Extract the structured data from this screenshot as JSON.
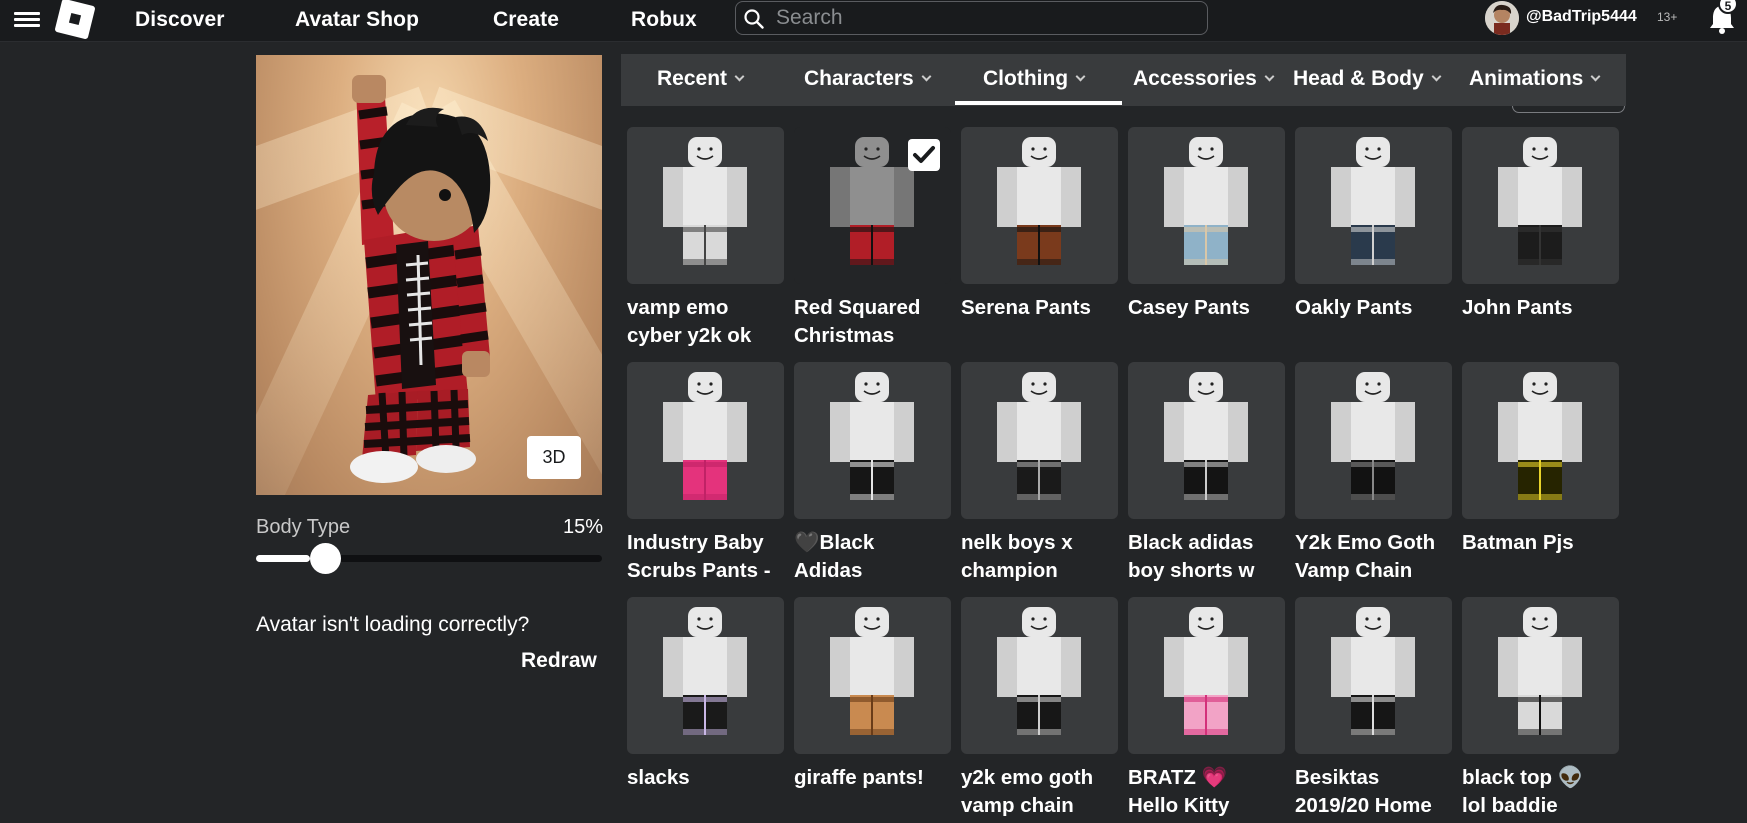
{
  "topbar": {
    "nav": [
      {
        "label": "Discover"
      },
      {
        "label": "Avatar Shop"
      },
      {
        "label": "Create"
      },
      {
        "label": "Robux"
      }
    ],
    "search_placeholder": "Search",
    "username": "@BadTrip5444",
    "age_tag": "13+",
    "notification_count": "5"
  },
  "preview": {
    "view_toggle_label": "3D",
    "body_type_label": "Body Type",
    "body_type_value": "15%",
    "body_type_fraction": 0.15,
    "loading_question": "Avatar isn't loading correctly?",
    "redraw_label": "Redraw"
  },
  "tabs": [
    {
      "label": "Recent"
    },
    {
      "label": "Characters"
    },
    {
      "label": "Clothing",
      "active": true
    },
    {
      "label": "Accessories"
    },
    {
      "label": "Head & Body"
    },
    {
      "label": "Animations"
    }
  ],
  "items": [
    {
      "line1": "vamp emo",
      "line2": "cyber y2k ok",
      "pants": "#d9d9d9",
      "accent": "#444"
    },
    {
      "line1": "Red Squared",
      "line2": "Christmas",
      "pants": "#b11e27",
      "accent": "#111",
      "selected": true
    },
    {
      "line1": "Serena Pants",
      "line2": "",
      "pants": "#7a3a1c",
      "accent": "#111"
    },
    {
      "line1": "Casey Pants",
      "line2": "",
      "pants": "#8fb2c8",
      "accent": "#d9c7a8"
    },
    {
      "line1": "Oakly Pants",
      "line2": "",
      "pants": "#2a3a4c",
      "accent": "#d0d0d0"
    },
    {
      "line1": "John Pants",
      "line2": "",
      "pants": "#1c1c1c",
      "accent": "#333"
    },
    {
      "line1": "Industry Baby",
      "line2": "Scrubs Pants -",
      "pants": "#e4337c",
      "accent": "#c02266"
    },
    {
      "line1": "🖤Black",
      "line2": "Adidas",
      "pants": "#161616",
      "accent": "#e6e6e6"
    },
    {
      "line1": "nelk boys x",
      "line2": "champion",
      "pants": "#1a1a1a",
      "accent": "#aaa"
    },
    {
      "line1": "Black adidas",
      "line2": "boy shorts w",
      "pants": "#141414",
      "accent": "#ccc"
    },
    {
      "line1": "Y2k Emo Goth",
      "line2": "Vamp Chain",
      "pants": "#121212",
      "accent": "#888"
    },
    {
      "line1": "Batman Pjs",
      "line2": "",
      "pants": "#262400",
      "accent": "#e8d22a"
    },
    {
      "line1": "slacks",
      "line2": "",
      "pants": "#1a1a1a",
      "accent": "#c9b7e6"
    },
    {
      "line1": "giraffe pants!",
      "line2": "",
      "pants": "#c98a50",
      "accent": "#6a3c18"
    },
    {
      "line1": "y2k emo goth",
      "line2": "vamp chain",
      "pants": "#171717",
      "accent": "#cfcfcf"
    },
    {
      "line1": "BRATZ 💗",
      "line2": "Hello Kitty",
      "pants": "#f2a3c6",
      "accent": "#d3307a"
    },
    {
      "line1": "Besiktas",
      "line2": "2019/20 Home",
      "pants": "#161616",
      "accent": "#ddd"
    },
    {
      "line1": "black top 👽",
      "line2": "lol baddie",
      "pants": "#d9d9d9",
      "accent": "#111"
    }
  ],
  "colors": {
    "background": "#232527",
    "topbar": "#191b1d",
    "tile": "#393b3d",
    "text": "#ffffff"
  }
}
